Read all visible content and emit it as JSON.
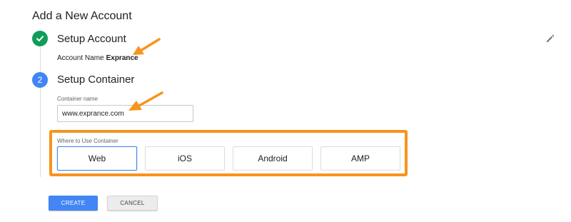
{
  "page": {
    "title": "Add a New Account"
  },
  "colors": {
    "accent": "#4285f4",
    "success": "#0f9d58",
    "highlight": "#f7941d"
  },
  "steps": [
    {
      "number": "1",
      "title": "Setup Account",
      "status": "completed",
      "icon": "check-icon"
    },
    {
      "number": "2",
      "title": "Setup Container",
      "status": "active"
    }
  ],
  "account": {
    "label": "Account Name",
    "value": "Exprance"
  },
  "container": {
    "name_label": "Container name",
    "name_value": "www.exprance.com"
  },
  "platform": {
    "label": "Where to Use Container",
    "options": [
      "Web",
      "iOS",
      "Android",
      "AMP"
    ],
    "selected": "Web"
  },
  "actions": {
    "create_label": "CREATE",
    "cancel_label": "CANCEL"
  },
  "icons": {
    "edit": "pencil-icon",
    "annotation": "arrow-annotation-icon"
  }
}
